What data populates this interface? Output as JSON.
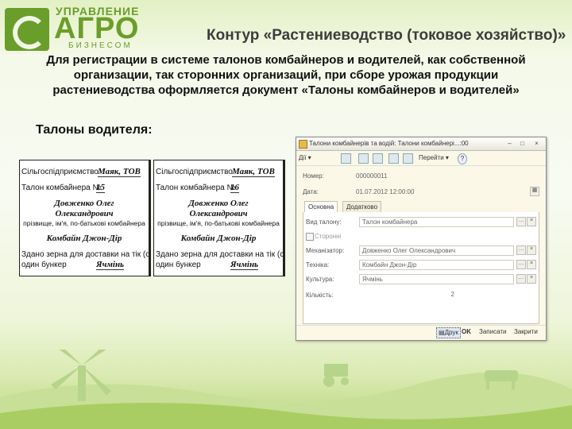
{
  "logo": {
    "line1": "УПРАВЛЕНИЕ",
    "line2": "АГРО",
    "line3": "БИЗНЕСОМ"
  },
  "slide_title": "Контур «Растениеводство (токовое хозяйство)»",
  "intro_text": "Для регистрации в системе талонов комбайнеров и водителей, как собственной организации, так сторонних организаций, при сборе урожая продукции растениеводства  оформляется документ «Талоны комбайнеров и водителей»",
  "subheading": "Талоны водителя:",
  "tickets": [
    {
      "org_label": "Сільгоспідприємство",
      "org_value": "Маяк, ТОВ",
      "num_label": "Талон комбайнера №",
      "num_value": "15",
      "name1": "Довженко Олег",
      "name2": "Олександрович",
      "name_caption": "прізвище, ім'я, по-батькові комбайнера",
      "machine": "Комбайн Джон-Дір",
      "line_a": "Здано зерна для доставки на тік (скла",
      "line_b": "один бункер",
      "crop": "Ячмінь"
    },
    {
      "org_label": "Сільгоспідприємство",
      "org_value": "Маяк, ТОВ",
      "num_label": "Талон комбайнера №",
      "num_value": "16",
      "name1": "Довженко Олег",
      "name2": "Олександрович",
      "name_caption": "прізвище, ім'я, по-батькові комбайнера",
      "machine": "Комбайн Джон-Дір",
      "line_a": "Здано зерна для доставки на тік (скла",
      "line_b": "один бункер",
      "crop": "Ячмінь"
    }
  ],
  "window": {
    "title": "Талони комбайнерів та водій: Талони комбайнері...:00",
    "toolbar": {
      "actions": "Дії",
      "goto": "Перейти",
      "help": "?"
    },
    "number_label": "Номер:",
    "number_value": "000000011",
    "date_label": "Дата:",
    "date_value": "01.07.2012 12:00:00",
    "tabs": [
      "Основна",
      "Додатково"
    ],
    "fields": {
      "type_label": "Вид талону:",
      "type_value": "Талон комбайнера",
      "third_party_label": "Сторонні",
      "operator_label": "Механізатор:",
      "operator_value": "Довженко Олег Олександрович",
      "machine_label": "Техніка:",
      "machine_value": "Комбайн Джон-Дір",
      "crop_label": "Культура:",
      "crop_value": "Ячмінь",
      "qty_label": "Кількість:",
      "qty_value": "2"
    },
    "buttons": {
      "print": "Друк",
      "ok": "OK",
      "save": "Записати",
      "close": "Закрити"
    }
  }
}
